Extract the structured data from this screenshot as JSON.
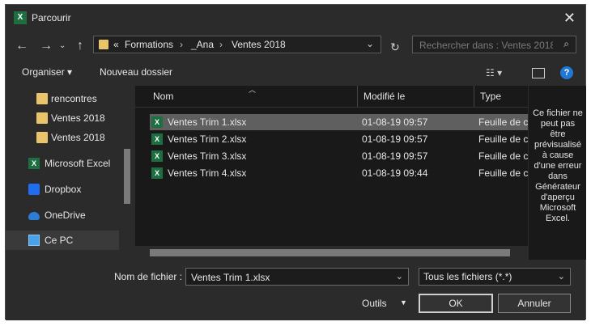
{
  "window": {
    "title": "Parcourir"
  },
  "address": {
    "overflow": "«",
    "crumbs": [
      "Formations",
      "_Ana",
      "Ventes 2018"
    ]
  },
  "search": {
    "placeholder": "Rechercher dans : Ventes 2018"
  },
  "toolbar": {
    "organize": "Organiser",
    "new_folder": "Nouveau dossier"
  },
  "sidebar": {
    "items": [
      {
        "label": "rencontres",
        "icon": "folder-icon"
      },
      {
        "label": "Ventes 2018",
        "icon": "folder-icon"
      },
      {
        "label": "Ventes 2018",
        "icon": "folder-icon"
      },
      {
        "label": "Microsoft Excel",
        "icon": "excel-icon"
      },
      {
        "label": "Dropbox",
        "icon": "dropbox-icon"
      },
      {
        "label": "OneDrive",
        "icon": "onedrive-icon"
      },
      {
        "label": "Ce PC",
        "icon": "computer-icon"
      }
    ]
  },
  "columns": {
    "name": "Nom",
    "modified": "Modifié le",
    "type": "Type"
  },
  "files": [
    {
      "name": "Ventes Trim 1.xlsx",
      "modified": "01-08-19 09:57",
      "type": "Feuille de calcul",
      "selected": true
    },
    {
      "name": "Ventes Trim 2.xlsx",
      "modified": "01-08-19 09:57",
      "type": "Feuille de calcul"
    },
    {
      "name": "Ventes Trim 3.xlsx",
      "modified": "01-08-19 09:57",
      "type": "Feuille de calcul"
    },
    {
      "name": "Ventes Trim 4.xlsx",
      "modified": "01-08-19 09:44",
      "type": "Feuille de calcul"
    }
  ],
  "preview": {
    "message": "Ce fichier ne peut pas être prévisualisé à cause d'une erreur dans Générateur d'aperçu Microsoft Excel."
  },
  "bottom": {
    "filename_label": "Nom de fichier :",
    "filename_value": "Ventes Trim 1.xlsx",
    "filter": "Tous les fichiers (*.*)",
    "tools": "Outils",
    "ok": "OK",
    "cancel": "Annuler"
  },
  "colors": {
    "accent": "#1e78d6",
    "folder": "#e9c46a",
    "excel": "#1d6f42"
  }
}
